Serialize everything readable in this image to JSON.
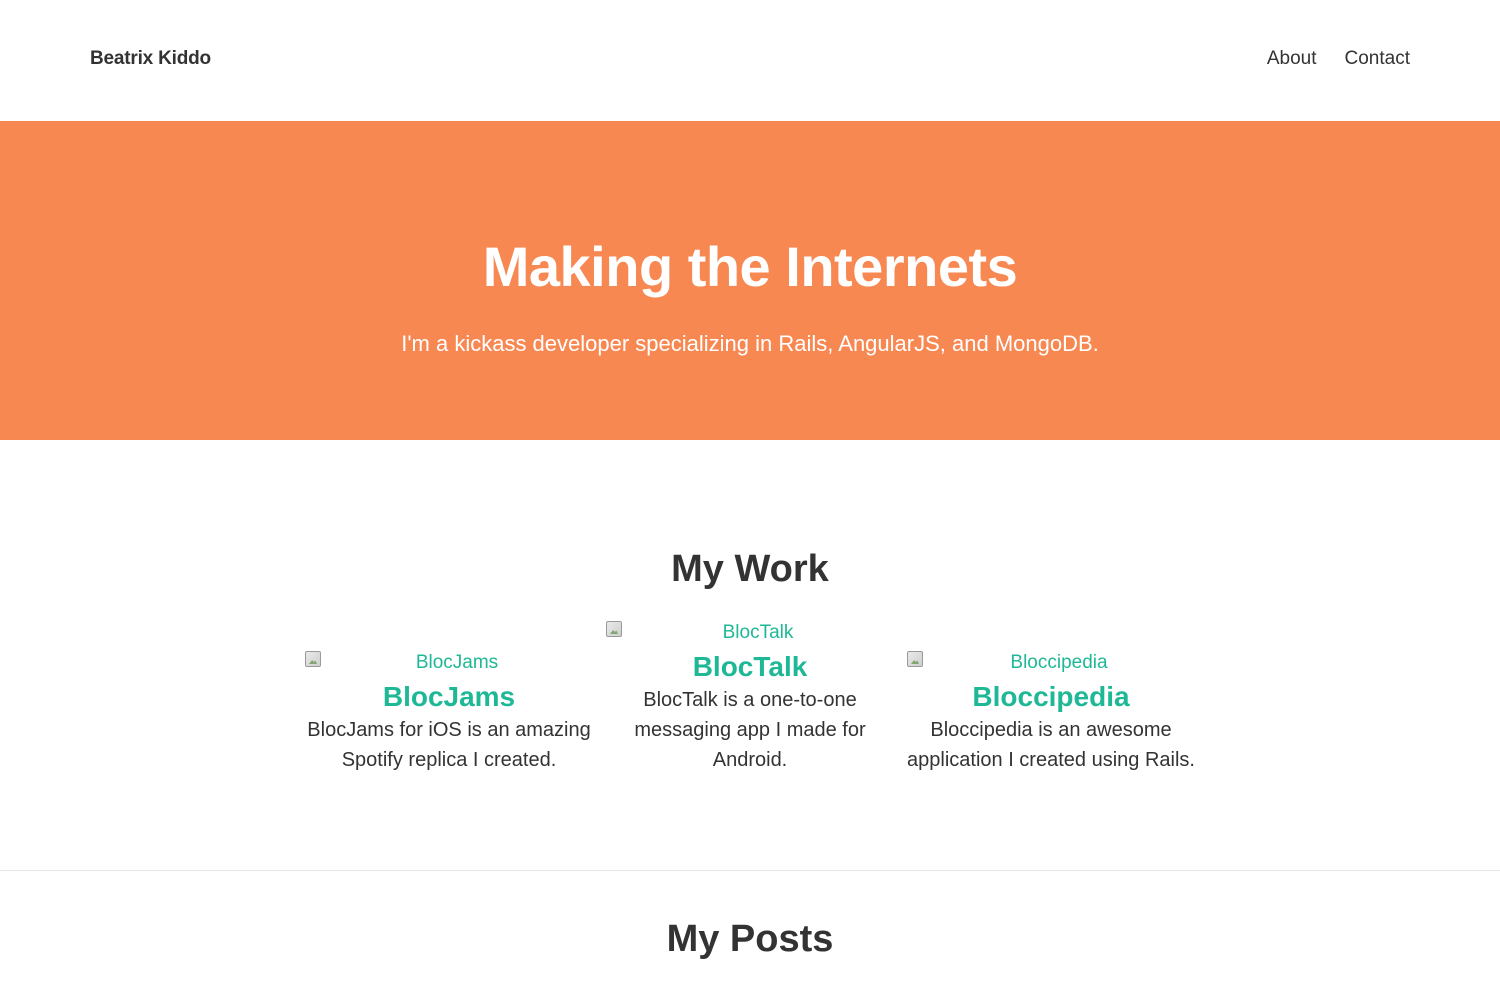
{
  "header": {
    "brand": "Beatrix Kiddo",
    "nav": [
      {
        "label": "About"
      },
      {
        "label": "Contact"
      }
    ]
  },
  "hero": {
    "title": "Making the Internets",
    "subtitle": "I'm a kickass developer specializing in Rails, AngularJS, and MongoDB."
  },
  "work": {
    "title": "My Work",
    "items": [
      {
        "image_alt": "BlocJams",
        "name": "BlocJams",
        "description": "BlocJams for iOS is an amazing Spotify replica I created."
      },
      {
        "image_alt": "BlocTalk",
        "name": "BlocTalk",
        "description": "BlocTalk is a one-to-one messaging app I made for Android."
      },
      {
        "image_alt": "Bloccipedia",
        "name": "Bloccipedia",
        "description": "Bloccipedia is an awesome application I created using Rails."
      }
    ]
  },
  "posts": {
    "title": "My Posts"
  },
  "colors": {
    "hero_background": "#f78852",
    "accent": "#1fb896",
    "text": "#333333"
  }
}
